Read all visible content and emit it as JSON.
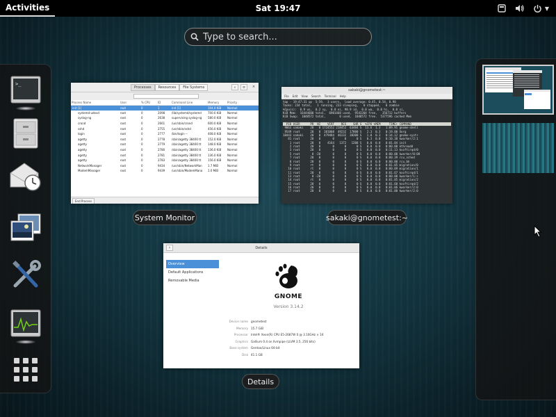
{
  "topbar": {
    "activities_label": "Activities",
    "clock": "Sat 19:47",
    "tray_icons": [
      "screen-icon",
      "volume-icon",
      "power-icon"
    ]
  },
  "search": {
    "placeholder": "Type to search..."
  },
  "dash": {
    "apps": [
      "terminal-icon",
      "files-icon",
      "evolution-icon",
      "image-viewer-icon",
      "settings-tools-icon",
      "system-monitor-icon",
      "show-applications-icon"
    ]
  },
  "windows": {
    "system_monitor": {
      "caption": "System Monitor",
      "tabs": [
        "Processes",
        "Resources",
        "File Systems"
      ],
      "columns": [
        "Process Name",
        "User",
        "% CPU",
        "ID",
        "Command Line",
        "Memory",
        "Priority"
      ],
      "rows": [
        [
          "init [1]",
          "root",
          "0",
          "1",
          "init [1]",
          "104.0 KiB",
          "Normal"
        ],
        [
          "systemd-udevd",
          "root",
          "0",
          "2098",
          "/lib/systemd/systemd",
          "700.0 KiB",
          "Normal"
        ],
        [
          "syslog-ng",
          "root",
          "0",
          "2638",
          "supervising syslog-ng",
          "580.0 KiB",
          "Normal"
        ],
        [
          "crond",
          "root",
          "0",
          "2661",
          "/usr/sbin/crond",
          "600.0 KiB",
          "Normal"
        ],
        [
          "sshd",
          "root",
          "0",
          "2755",
          "/usr/sbin/sshd",
          "456.0 KiB",
          "Normal"
        ],
        [
          "login",
          "root",
          "0",
          "2777",
          "/bin/login --",
          "408.0 KiB",
          "Normal"
        ],
        [
          "agetty",
          "root",
          "0",
          "2778",
          "/sbin/agetty 38400 tt",
          "152.0 KiB",
          "Normal"
        ],
        [
          "agetty",
          "root",
          "0",
          "2779",
          "/sbin/agetty 38400 tt",
          "148.0 KiB",
          "Normal"
        ],
        [
          "agetty",
          "root",
          "0",
          "2780",
          "/sbin/agetty 38400 tt",
          "136.0 KiB",
          "Normal"
        ],
        [
          "agetty",
          "root",
          "0",
          "2781",
          "/sbin/agetty 38400 tt",
          "136.0 KiB",
          "Normal"
        ],
        [
          "agetty",
          "root",
          "0",
          "2783",
          "/sbin/agetty 38400 tt",
          "156.0 KiB",
          "Normal"
        ],
        [
          "NetworkManager",
          "root",
          "0",
          "9434",
          "/usr/sbin/NetworkMan",
          "1.7 MiB",
          "Normal"
        ],
        [
          "ModemManager",
          "root",
          "0",
          "9439",
          "/usr/sbin/ModemMana",
          "1.0 MiB",
          "Normal"
        ]
      ],
      "end_process_label": "End Process"
    },
    "terminal": {
      "caption": "sakaki@gnometest:~",
      "title": "sakaki@gnometest:~",
      "menu": [
        "File",
        "Edit",
        "View",
        "Search",
        "Terminal",
        "Help"
      ],
      "header_lines": [
        "top - 19:47:31 up  5:59,  3 users,  load average: 0.45, 0.54, 0.90",
        "Tasks: 234 total,   1 running, 233 sleeping,   0 stopped,   0 zombie",
        "%Cpu(s):  0.9 us,  0.2 sy,  0.0 ni, 98.9 id,  0.0 wa,  0.0 hi,  0.0 si,",
        "KiB Mem:  16444600 total,  6901460 used,  9543204 free,   356712 buffers",
        "KiB Swap:  1048572 total,        0 used,  1048572 free.  5377596 cached Mem"
      ],
      "table_header": "  PID USER      PR  NI    VIRT    RES    SHR S  %CPU %MEM     TIME+ COMMAND",
      "table_lines": [
        " 9063 sakaki    20   0 1724552 218452  63484 S  13.6  1.3   1:09.91 gnome-shell",
        " 9549 root      20   0  381008  49232  17800 S   2.3  0.3   0:19.00 Xorg",
        "10443 sakaki    20   0  479484  46132  30308 S   1.0  0.3   0:14.12 gnome-syst+",
        "   81 root      20   0       0      0      0 S   0.3  0.0   0:10.38 kworker/2:1",
        "    1 root      20   0    4164   1372   1208 S   0.0  0.0   0:01.04 init",
        "    2 root      20   0       0      0      0 S   0.0  0.0   0:00.00 kthreadd",
        "    3 root      20   0       0      0      0 S   0.0  0.0   0:11.13 ksoftirqd/0",
        "    5 root       0 -20       0      0      0 S   0.0  0.0   0:00.00 kworker/0:0H",
        "    7 root      20   0       0      0      0 S   0.0  0.0   0:00.39 rcu_sched",
        "    8 root      20   0       0      0      0 S   0.0  0.0   0:00.00 rcu_bh",
        "    9 root      rt   0       0      0      0 S   0.0  0.0   0:01.05 migration/0",
        "   10 root      rt   0       0      0      0 S   0.0  0.0   0:00.09 migration/1",
        "   11 root      20   0       0      0      0 S   0.0  0.0   0:01.67 ksoftirqd/1",
        "   13 root       0 -20       0      0      0 S   0.0  0.0   0:00.00 kworker/1:+",
        "   14 root      rt   0       0      0      0 S   0.0  0.0   0:01.05 migration/2",
        "   15 root      20   0       0      0      0 S   0.0  0.0   0:01.60 ksoftirqd/2",
        "   16 root      20   0       0      0      0 S   0.0  0.0   0:01.06 kworker/2:0",
        "   17 root      20   0       0      0      0 S   0.0  0.0   0:01.00 kworker/2:0"
      ]
    },
    "details": {
      "caption": "Details",
      "title": "Details",
      "sidebar": [
        "Overview",
        "Default Applications",
        "Removable Media"
      ],
      "logo_text": "GNOME",
      "version": "Version 3.14.2",
      "info": [
        {
          "key": "Device name",
          "value": "gnometest"
        },
        {
          "key": "Memory",
          "value": "15.7 GiB"
        },
        {
          "key": "Processor",
          "value": "Intel® Xeon(R) CPU E5-2687W 0 @ 3.10GHz × 16"
        },
        {
          "key": "Graphics",
          "value": "Gallium 0.4 on llvmpipe (LLVM 3.5, 256 bits)"
        },
        {
          "key": "Base system",
          "value": "Gentoo/Linux 64-bit"
        },
        {
          "key": "Disk",
          "value": "41.1 GB"
        }
      ]
    }
  },
  "colors": {
    "accent": "#4a90d9",
    "topbar": "#000000",
    "terminal_bg": "#2e3436"
  }
}
